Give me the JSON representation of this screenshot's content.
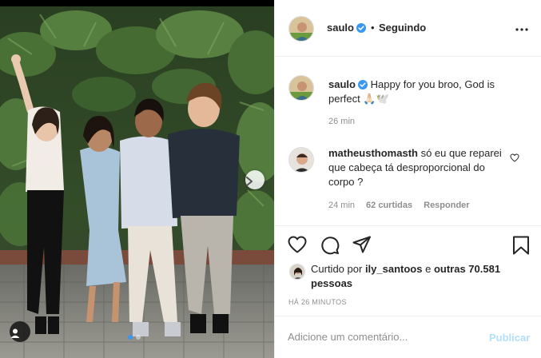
{
  "post": {
    "author": "saulo",
    "separator": "•",
    "follow_status": "Seguindo"
  },
  "caption": {
    "username": "saulo",
    "text": "Happy for you broo, God is perfect 🙏🏻🕊️",
    "time": "26 min"
  },
  "comment": {
    "username": "matheusthomasth",
    "text": "só eu que reparei que cabeça tá desproporcional do corpo ?",
    "time": "24 min",
    "likes": "62 curtidas",
    "reply": "Responder"
  },
  "likes": {
    "prefix": "Curtido por",
    "user": "ily_santoos",
    "connector": "e",
    "others": "outras 70.581 pessoas"
  },
  "posted_ago": "HÁ 26 MINUTOS",
  "add_comment": {
    "placeholder": "Adicione um comentário...",
    "publish_label": "Publicar"
  },
  "carousel": {
    "total": 2,
    "current": 1
  },
  "colors": {
    "verified_blue": "#3897f0",
    "publish_disabled": "#b2dffc",
    "muted_text": "#8e8e8e"
  },
  "icons": [
    "verified-badge-icon",
    "more-options-icon",
    "heart-icon",
    "comment-icon",
    "share-icon",
    "bookmark-icon",
    "next-arrow-icon",
    "user-tag-icon"
  ]
}
